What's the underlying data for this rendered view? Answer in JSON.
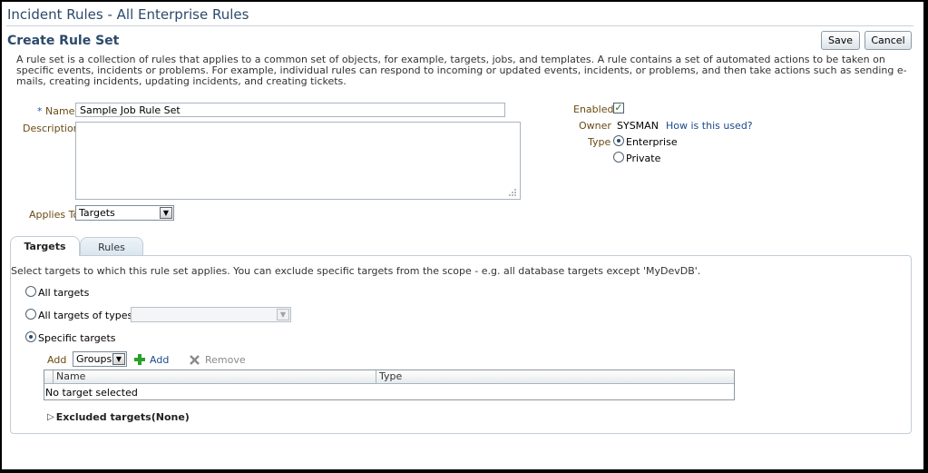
{
  "page": {
    "title": "Incident Rules - All Enterprise Rules",
    "section_title": "Create Rule Set",
    "intro": "A rule set is a collection of rules that applies to a common set of objects, for example, targets, jobs, and templates. A rule contains a set of automated actions to be taken on specific events, incidents or problems. For example, individual rules can respond to incoming or updated events, incidents, or problems, and then take actions such as sending e-mails, creating incidents, updating incidents, and creating tickets."
  },
  "toolbar": {
    "save_label": "Save",
    "cancel_label": "Cancel"
  },
  "form": {
    "name_required_marker": "*",
    "name_label": "Name",
    "name_value": "Sample Job Rule Set",
    "description_label": "Description",
    "description_value": "",
    "applies_to_label": "Applies To",
    "applies_to_value": "Targets",
    "enabled_label": "Enabled",
    "enabled_checked": true,
    "owner_label": "Owner",
    "owner_value": "SYSMAN",
    "owner_help_link": "How is this used?",
    "type_label": "Type",
    "type_options": [
      "Enterprise",
      "Private"
    ],
    "type_selected": "Enterprise"
  },
  "tabs": [
    {
      "label": "Targets",
      "active": true
    },
    {
      "label": "Rules",
      "active": false
    }
  ],
  "targets_tab": {
    "instructions": "Select targets to which this rule set applies. You can exclude specific targets from the scope - e.g. all database targets except 'MyDevDB'.",
    "options": [
      {
        "label": "All targets",
        "selected": false
      },
      {
        "label": "All targets of types",
        "selected": false
      },
      {
        "label": "Specific targets",
        "selected": true
      }
    ],
    "types_select_value": "",
    "add_label": "Add",
    "add_type_value": "Groups",
    "add_button_label": "Add",
    "remove_button_label": "Remove",
    "table": {
      "columns": [
        "Name",
        "Type"
      ],
      "empty_message": "No target selected"
    },
    "excluded_label": "Excluded targets(None)"
  },
  "colors": {
    "header_text": "#2c4a6b",
    "label_text": "#6b4a12",
    "link": "#1a4a8a",
    "add_icon": "#2aa02a",
    "remove_icon": "#8a8a8a"
  },
  "icons": {
    "enabled_check": "checkmark-icon",
    "add": "plus-icon",
    "remove": "x-icon",
    "excluded_toggle": "triangle-right-icon",
    "resize": "resize-grip-icon"
  }
}
